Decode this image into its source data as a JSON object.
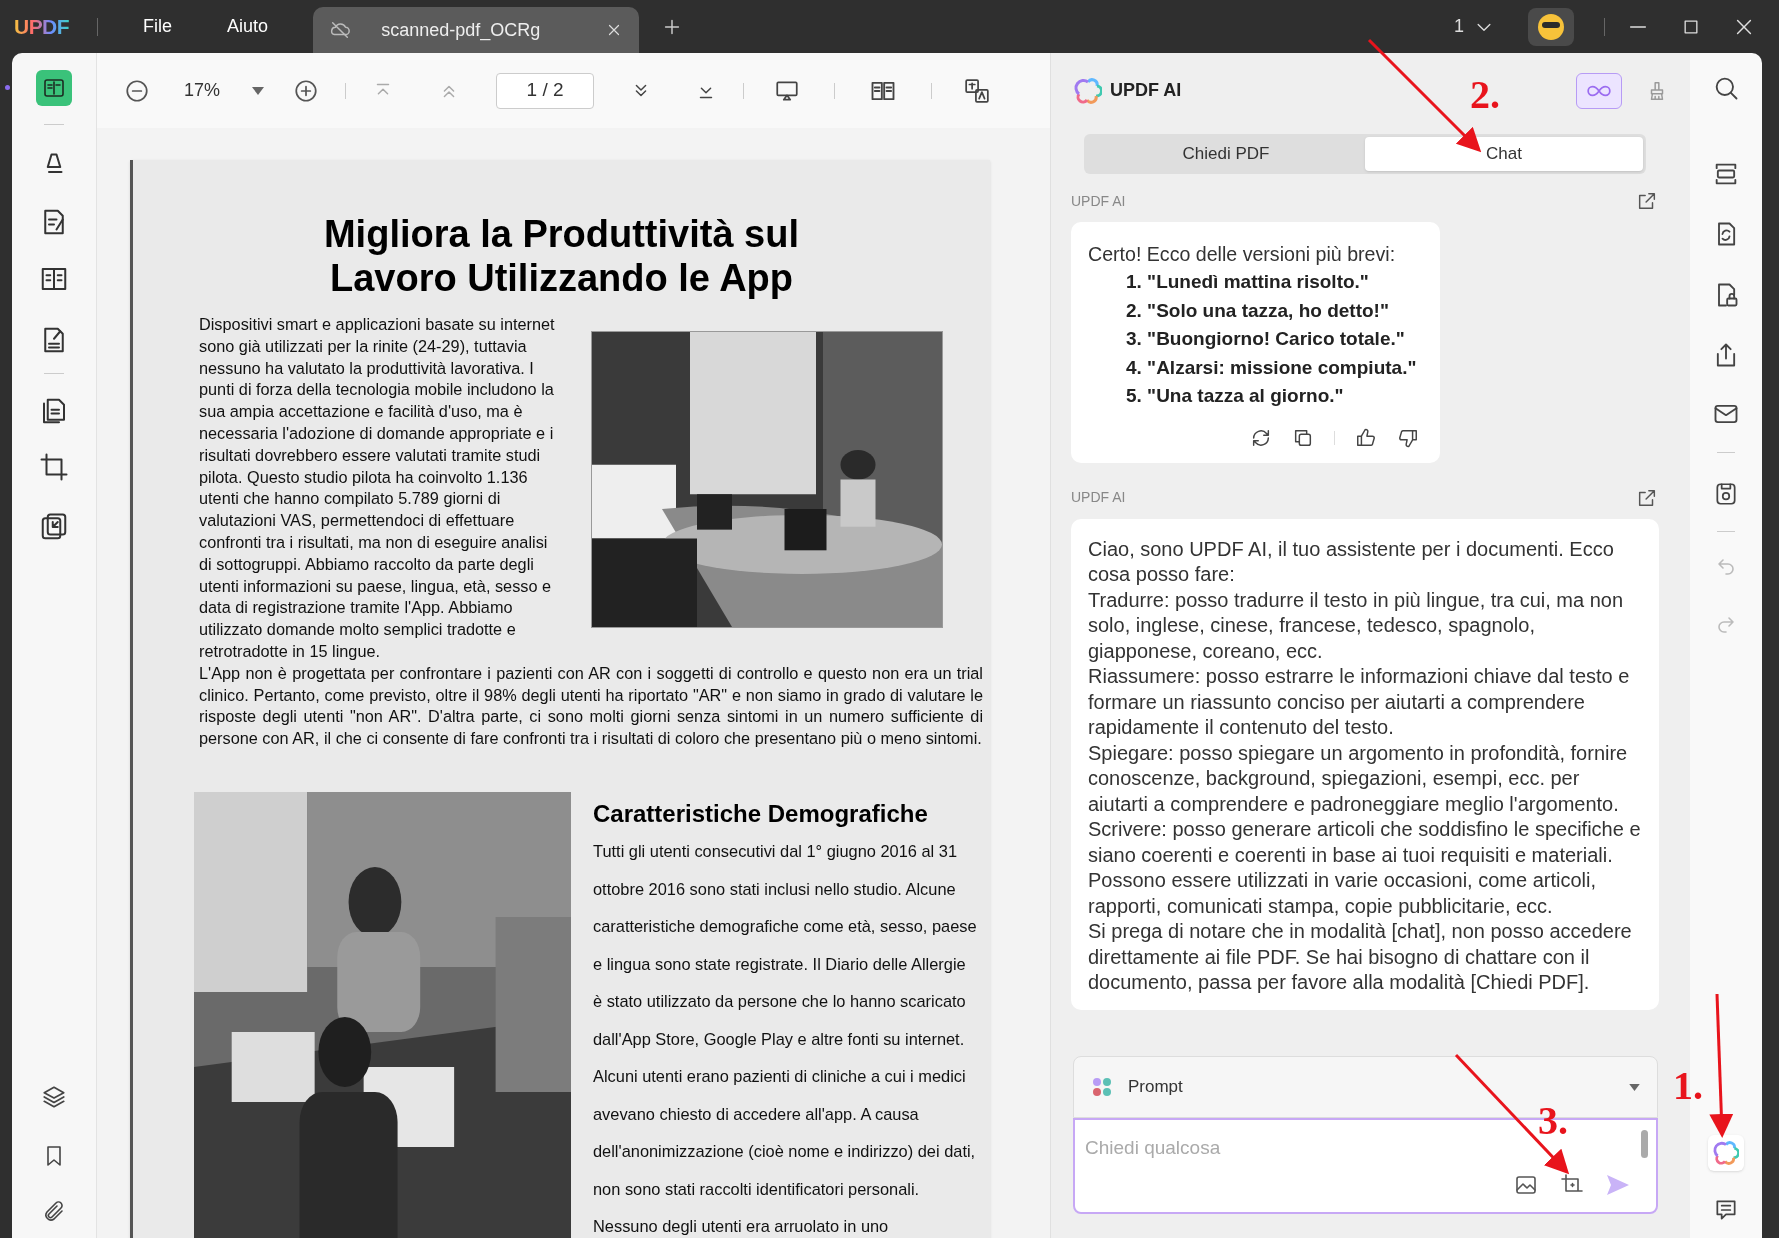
{
  "titlebar": {
    "logo": "UPDF",
    "menu": [
      {
        "label": "File"
      },
      {
        "label": "Aiuto"
      }
    ],
    "tabs": [
      {
        "title": "scanned-pdf_OCRg",
        "selected": true
      }
    ],
    "page_indicator": "1"
  },
  "toolbar": {
    "zoom": "17%",
    "page": "1 / 2"
  },
  "document": {
    "title_lines": [
      "Migliora la Produttività sul",
      "Lavoro Utilizzando le App"
    ],
    "intro": "Dispositivi smart e applicazioni basate su internet sono già utilizzati per la rinite (24-29), tuttavia nessuno ha valutato la produttività lavorativa. I punti di forza della tecnologia mobile includono la sua ampia accettazione e facilità d'uso, ma è necessaria l'adozione di domande appropriate e i risultati dovrebbero essere valutati tramite studi pilota. Questo studio pilota ha coinvolto 1.136 utenti che hanno compilato 5.789 giorni di valutazioni VAS, permettendoci di effettuare confronti tra i risultati, ma non di eseguire analisi di sottogruppi. Abbiamo raccolto da parte degli utenti informazioni su paese, lingua, età, sesso e data di registrazione tramite l'App. Abbiamo utilizzato domande molto semplici tradotte e retrotradotte in 15 lingue.",
    "body": "L'App non è progettata per confrontare i pazienti con AR con i soggetti di controllo e questo non era un trial clinico. Pertanto, come previsto, oltre il 98% degli utenti ha riportato \"AR\" e non siamo in grado di valutare le risposte degli utenti \"non AR\". D'altra parte, ci sono molti giorni senza sintomi in un numero sufficiente di persone con AR, il che ci consente di fare confronti tra i risultati di coloro che presentano più o meno sintomi.",
    "section_heading": "Caratteristiche Demografiche",
    "section_text": "Tutti gli utenti consecutivi dal 1° giugno 2016 al 31 ottobre 2016 sono stati inclusi nello studio. Alcune caratteristiche demografiche come età, sesso, paese e lingua sono state registrate. Il Diario delle Allergie è stato utilizzato da persone che lo hanno scaricato dall'App Store, Google Play e altre fonti su internet. Alcuni utenti erano pazienti di cliniche a cui i medici avevano chiesto di accedere all'app. A causa dell'anonimizzazione (cioè nome e indirizzo) dei dati, non sono stati raccolti identificatori personali. Nessuno degli utenti era arruolato in uno"
  },
  "ai_panel": {
    "title": "UPDF AI",
    "tabs": [
      {
        "label": "Chiedi PDF",
        "selected": false
      },
      {
        "label": "Chat",
        "selected": true
      }
    ],
    "messages": [
      {
        "sender": "UPDF AI",
        "paragraphs": [
          "Certo! Ecco delle versioni più brevi:"
        ],
        "list": [
          "1. \"Lunedì mattina risolto.\"",
          "2. \"Solo una tazza, ho detto!\"",
          "3. \"Buongiorno! Carico totale.\"",
          "4. \"Alzarsi: missione compiuta.\"",
          "5. \"Una tazza al giorno.\""
        ],
        "actions": true
      },
      {
        "sender": "UPDF AI",
        "paragraphs": [
          "Ciao, sono UPDF AI, il tuo assistente per i documenti. Ecco cosa posso fare:",
          "Tradurre: posso tradurre il testo in più lingue, tra cui, ma non solo, inglese, cinese, francese, tedesco, spagnolo, giapponese, coreano, ecc.",
          "Riassumere: posso estrarre le informazioni chiave dal testo e formare un riassunto conciso per aiutarti a comprendere rapidamente il contenuto del testo.",
          "Spiegare: posso spiegare un argomento in profondità, fornire conoscenze, background, spiegazioni, esempi, ecc. per aiutarti a comprendere e padroneggiare meglio l'argomento.",
          "Scrivere: posso generare articoli che soddisfino le specifiche e siano coerenti e coerenti in base ai tuoi requisiti e materiali.",
          "Possono essere utilizzati in varie occasioni, come articoli, rapporti, comunicati stampa, copie pubblicitarie, ecc.",
          "Si prega di notare che in modalità [chat], non posso accedere direttamente ai file PDF. Se hai bisogno di chattare con il documento, passa per favore alla modalità [Chiedi PDF]."
        ],
        "actions": false
      }
    ],
    "prompt": {
      "label": "Prompt",
      "placeholder": "Chiedi qualcosa"
    }
  },
  "annotations": [
    {
      "label": "2."
    },
    {
      "label": "3."
    },
    {
      "label": "1."
    }
  ]
}
